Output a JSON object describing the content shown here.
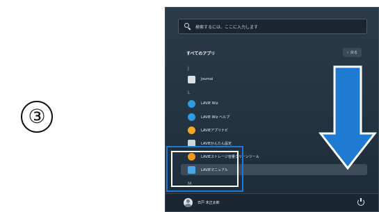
{
  "step_marker": "③",
  "search": {
    "placeholder_text": "検索するには、ここに入力します"
  },
  "all_apps": {
    "title": "すべてのアプリ",
    "back_label": "戻る"
  },
  "letters": [
    "J",
    "L",
    "M"
  ],
  "apps": [
    {
      "label": "Journal",
      "icon": "journal-icon",
      "color": "#d9dfe4"
    },
    {
      "label": "LAVIE Wiz",
      "icon": "lavie-wiz-icon",
      "color": "#2f9be0"
    },
    {
      "label": "LAVIE Wiz ヘルプ",
      "icon": "lavie-wiz-help-icon",
      "color": "#2f9be0"
    },
    {
      "label": "LAVIEアプリナビ",
      "icon": "lavie-app-navi-icon",
      "color": "#f4a623"
    },
    {
      "label": "LAVIEかんたん設定",
      "icon": "lavie-easy-settings-icon",
      "color": "#cdd6de"
    },
    {
      "label": "LAVIEストレージ容量クリーンツール",
      "icon": "lavie-storage-cleaner-icon",
      "color": "#f39a1e"
    },
    {
      "label": "LAVIEマニュアル",
      "icon": "lavie-manual-icon",
      "color": "#4aa6e8",
      "selected": true
    }
  ],
  "user": {
    "name": "日戸 未正太郎"
  },
  "colors": {
    "arrow_fill": "#1f7bd1",
    "highlight_outer": "#1f7bd1",
    "menu_bg": "#223241"
  }
}
